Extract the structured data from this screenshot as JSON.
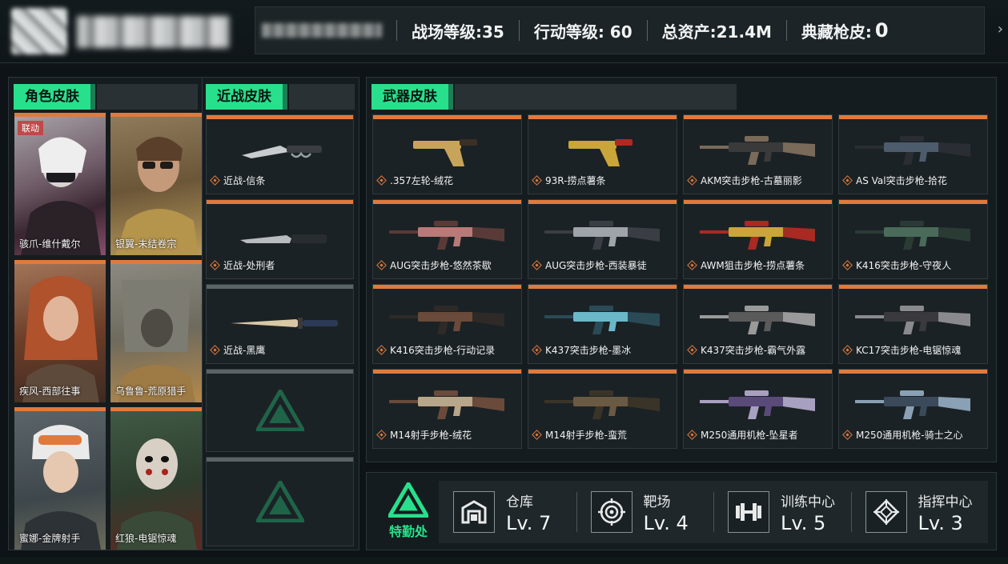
{
  "header": {
    "stats": [
      {
        "label": "战场等级:35"
      },
      {
        "label": "行动等级: 60"
      },
      {
        "label": "总资产:21.4M"
      },
      {
        "label": "典藏枪皮:"
      },
      {
        "label": "0"
      }
    ]
  },
  "panels": {
    "character_title": "角色皮肤",
    "melee_title": "近战皮肤",
    "weapon_title": "武器皮肤"
  },
  "characters": [
    {
      "label": "骇爪-维什戴尔",
      "badge": "联动"
    },
    {
      "label": "银翼-未结卷宗"
    },
    {
      "label": "疾风-西部往事"
    },
    {
      "label": "乌鲁鲁-荒原猎手"
    },
    {
      "label": "蜜娜-金牌射手"
    },
    {
      "label": "红狼-电锯惊魂"
    }
  ],
  "melee": [
    {
      "label": "近战-信条"
    },
    {
      "label": "近战-处刑者"
    },
    {
      "label": "近战-黑鹰"
    }
  ],
  "weapons": [
    {
      "label": ".357左轮-绒花"
    },
    {
      "label": "93R-捞点薯条"
    },
    {
      "label": "AKM突击步枪-古墓丽影"
    },
    {
      "label": "AS Val突击步枪-拾花"
    },
    {
      "label": "AUG突击步枪-悠然茶歇"
    },
    {
      "label": "AUG突击步枪-西装暴徒"
    },
    {
      "label": "AWM狙击步枪-捞点薯条"
    },
    {
      "label": "K416突击步枪-守夜人"
    },
    {
      "label": "K416突击步枪-行动记录"
    },
    {
      "label": "K437突击步枪-墨冰"
    },
    {
      "label": "K437突击步枪-霸气外露"
    },
    {
      "label": "KC17突击步枪-电锯惊魂"
    },
    {
      "label": "M14射手步枪-绒花"
    },
    {
      "label": "M14射手步枪-蛮荒"
    },
    {
      "label": "M250通用机枪-坠星者"
    },
    {
      "label": "M250通用机枪-骑士之心"
    }
  ],
  "bottom": {
    "logo_label": "特勤处",
    "facilities": [
      {
        "name": "仓库",
        "level": "Lv. 7",
        "icon": "warehouse-icon"
      },
      {
        "name": "靶场",
        "level": "Lv. 4",
        "icon": "target-icon"
      },
      {
        "name": "训练中心",
        "level": "Lv. 5",
        "icon": "dumbbell-icon"
      },
      {
        "name": "指挥中心",
        "level": "Lv. 3",
        "icon": "command-icon"
      }
    ]
  },
  "colors": {
    "accent_green": "#28e08b",
    "accent_orange": "#e07a3c"
  }
}
